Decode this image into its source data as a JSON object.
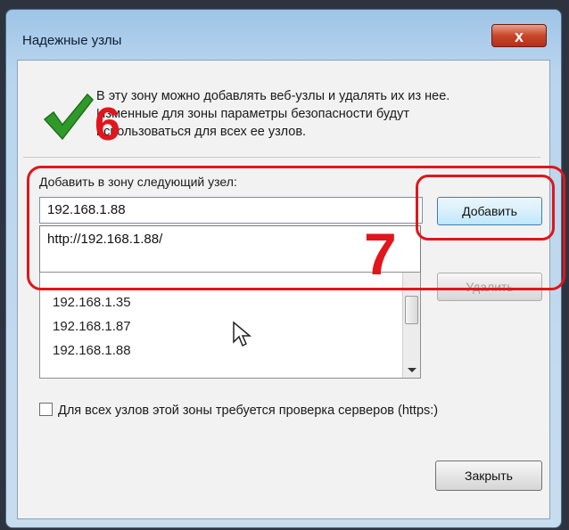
{
  "window": {
    "title": "Надежные узлы",
    "close_glyph": "x"
  },
  "info": {
    "line1": "В эту зону можно добавлять веб-узлы и удалять их из нее.",
    "line2": "Изменные для зоны параметры безопасности будут",
    "line3": "использоваться для всех ее узлов."
  },
  "annotations": {
    "step6": "6",
    "step7": "7"
  },
  "add_site": {
    "label": "Добавить в зону следующий узел:",
    "value": "192.168.1.88",
    "autocomplete": "http://192.168.1.88/",
    "add_button": "Добавить"
  },
  "sites": {
    "items": [
      "192.168.1.35",
      "192.168.1.87",
      "192.168.1.88"
    ],
    "remove_button": "Удалить"
  },
  "options": {
    "https_label": "Для всех узлов этой зоны требуется проверка серверов (https:)",
    "https_checked": false
  },
  "footer": {
    "close_button": "Закрыть"
  },
  "icons": {
    "checkmark": "check-icon",
    "cursor": "mouse-cursor-icon"
  },
  "colors": {
    "annotation": "#e1151b",
    "check_green": "#2f9a2a"
  }
}
